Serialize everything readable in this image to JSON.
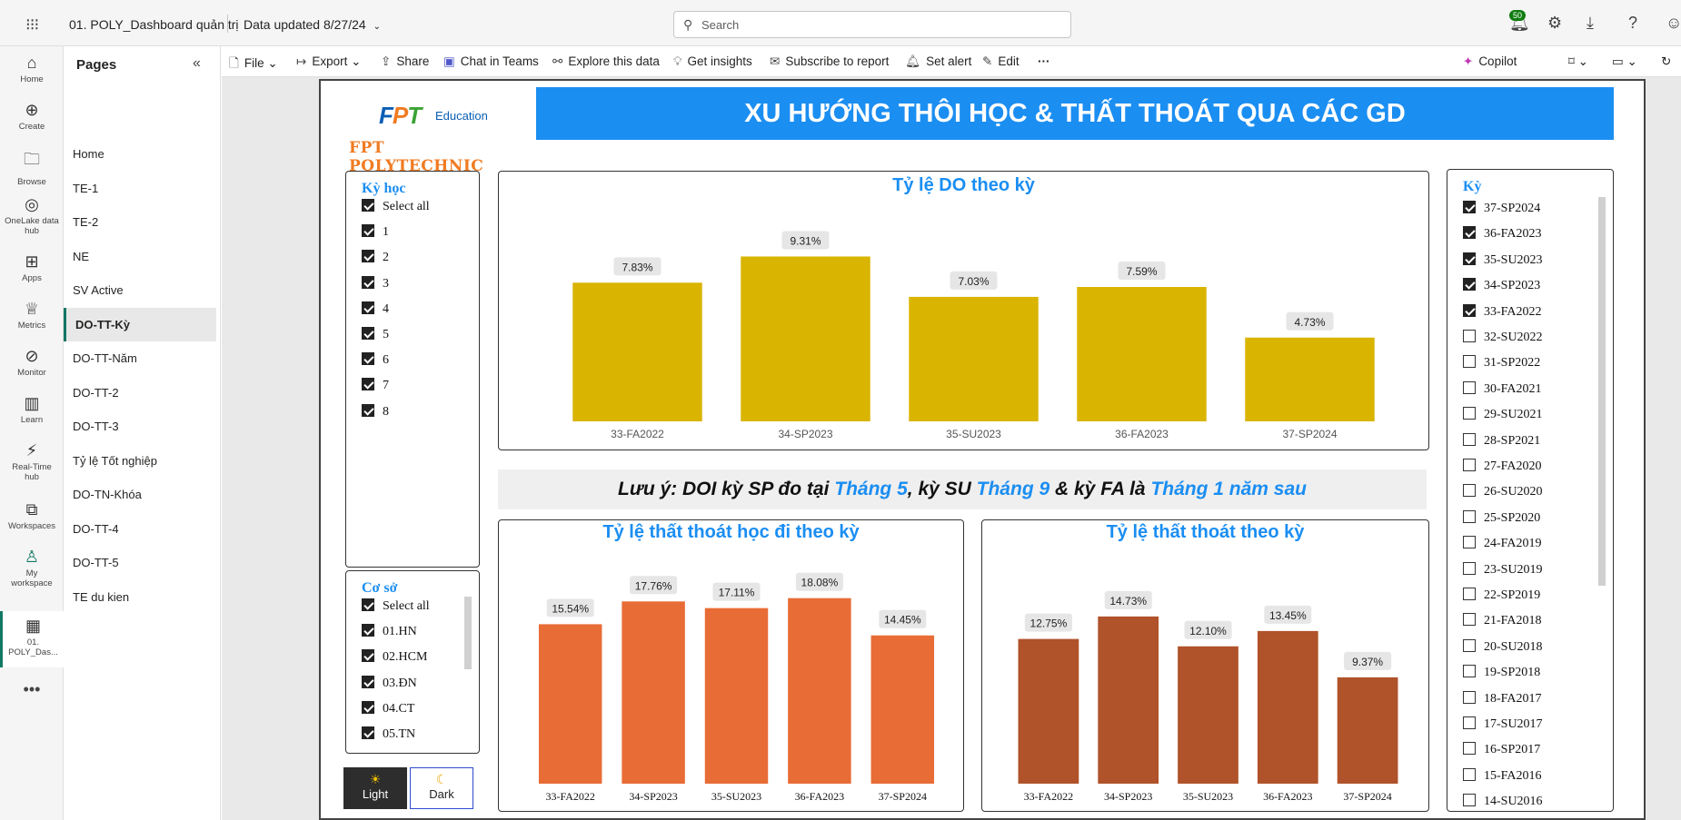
{
  "topbar": {
    "report_title": "01. POLY_Dashboard quản trị",
    "data_updated": "Data updated 8/27/24",
    "search_placeholder": "Search",
    "notif_count": "50"
  },
  "rail": [
    {
      "label": "Home",
      "icon": "home-icon"
    },
    {
      "label": "Create",
      "icon": "plus-circle-icon"
    },
    {
      "label": "Browse",
      "icon": "folder-icon"
    },
    {
      "label": "OneLake data hub",
      "icon": "onelake-icon"
    },
    {
      "label": "Apps",
      "icon": "apps-icon"
    },
    {
      "label": "Metrics",
      "icon": "trophy-icon"
    },
    {
      "label": "Monitor",
      "icon": "monitor-icon"
    },
    {
      "label": "Learn",
      "icon": "book-icon"
    },
    {
      "label": "Real-Time hub",
      "icon": "realtime-icon"
    },
    {
      "label": "Workspaces",
      "icon": "workspaces-icon"
    },
    {
      "label": "My workspace",
      "icon": "person-icon"
    },
    {
      "label": "01. POLY_Das...",
      "icon": "report-icon"
    }
  ],
  "pages": {
    "header": "Pages",
    "items": [
      "Home",
      "TE-1",
      "TE-2",
      "NE",
      "SV Active",
      "DO-TT-Kỳ",
      "DO-TT-Năm",
      "DO-TT-2",
      "DO-TT-3",
      "Tỷ lệ Tốt nghiệp",
      "DO-TN-Khóa",
      "DO-TT-4",
      "DO-TT-5",
      "TE du kien"
    ],
    "active": "DO-TT-Kỳ"
  },
  "commands": [
    "File",
    "Export",
    "Share",
    "Chat in Teams",
    "Explore this data",
    "Get insights",
    "Subscribe to report",
    "Set alert",
    "Edit"
  ],
  "copilot": "Copilot",
  "report": {
    "logo_fpt": "FPT",
    "logo_edu": "Education",
    "logo_poly": "FPT POLYTECHNIC",
    "title": "XU HƯỚNG THÔI HỌC & THẤT THOÁT QUA CÁC GD",
    "note_parts": [
      "Lưu ý: DOI kỳ SP đo tại ",
      "Tháng 5",
      ", kỳ SU ",
      "Tháng 9",
      " & kỳ FA là ",
      "Tháng 1 năm sau"
    ],
    "ky_hoc_slicer": {
      "title": "Kỳ học",
      "items": [
        {
          "label": "Select all",
          "checked": true
        },
        {
          "label": "1",
          "checked": true
        },
        {
          "label": "2",
          "checked": true
        },
        {
          "label": "3",
          "checked": true
        },
        {
          "label": "4",
          "checked": true
        },
        {
          "label": "5",
          "checked": true
        },
        {
          "label": "6",
          "checked": true
        },
        {
          "label": "7",
          "checked": true
        },
        {
          "label": "8",
          "checked": true
        }
      ]
    },
    "co_so_slicer": {
      "title": "Cơ sở",
      "items": [
        {
          "label": "Select all",
          "checked": true
        },
        {
          "label": "01.HN",
          "checked": true
        },
        {
          "label": "02.HCM",
          "checked": true
        },
        {
          "label": "03.ĐN",
          "checked": true
        },
        {
          "label": "04.CT",
          "checked": true
        },
        {
          "label": "05.TN",
          "checked": true
        }
      ]
    },
    "ky_slicer": {
      "title": "Kỳ",
      "items": [
        {
          "label": "37-SP2024",
          "checked": true
        },
        {
          "label": "36-FA2023",
          "checked": true
        },
        {
          "label": "35-SU2023",
          "checked": true
        },
        {
          "label": "34-SP2023",
          "checked": true
        },
        {
          "label": "33-FA2022",
          "checked": true
        },
        {
          "label": "32-SU2022",
          "checked": false
        },
        {
          "label": "31-SP2022",
          "checked": false
        },
        {
          "label": "30-FA2021",
          "checked": false
        },
        {
          "label": "29-SU2021",
          "checked": false
        },
        {
          "label": "28-SP2021",
          "checked": false
        },
        {
          "label": "27-FA2020",
          "checked": false
        },
        {
          "label": "26-SU2020",
          "checked": false
        },
        {
          "label": "25-SP2020",
          "checked": false
        },
        {
          "label": "24-FA2019",
          "checked": false
        },
        {
          "label": "23-SU2019",
          "checked": false
        },
        {
          "label": "22-SP2019",
          "checked": false
        },
        {
          "label": "21-FA2018",
          "checked": false
        },
        {
          "label": "20-SU2018",
          "checked": false
        },
        {
          "label": "19-SP2018",
          "checked": false
        },
        {
          "label": "18-FA2017",
          "checked": false
        },
        {
          "label": "17-SU2017",
          "checked": false
        },
        {
          "label": "16-SP2017",
          "checked": false
        },
        {
          "label": "15-FA2016",
          "checked": false
        },
        {
          "label": "14-SU2016",
          "checked": false
        }
      ]
    },
    "theme": {
      "light": "Light",
      "dark": "Dark",
      "active": "Light"
    }
  },
  "chart_data": [
    {
      "type": "bar",
      "title": "Tỷ lệ DO theo kỳ",
      "categories": [
        "33-FA2022",
        "34-SP2023",
        "35-SU2023",
        "36-FA2023",
        "37-SP2024"
      ],
      "values": [
        7.83,
        9.31,
        7.03,
        7.59,
        4.73
      ],
      "labels": [
        "7.83%",
        "9.31%",
        "7.03%",
        "7.59%",
        "4.73%"
      ],
      "color": "#d9b400",
      "ylim": [
        0,
        10
      ]
    },
    {
      "type": "bar",
      "title": "Tỷ lệ thất thoát học đi theo kỳ",
      "categories": [
        "33-FA2022",
        "34-SP2023",
        "35-SU2023",
        "36-FA2023",
        "37-SP2024"
      ],
      "values": [
        15.54,
        17.76,
        17.11,
        18.08,
        14.45
      ],
      "labels": [
        "15.54%",
        "17.76%",
        "17.11%",
        "18.08%",
        "14.45%"
      ],
      "color": "#e86c35",
      "ylim": [
        0,
        20
      ]
    },
    {
      "type": "bar",
      "title": "Tỷ lệ thất thoát theo kỳ",
      "categories": [
        "33-FA2022",
        "34-SP2023",
        "35-SU2023",
        "36-FA2023",
        "37-SP2024"
      ],
      "values": [
        12.75,
        14.73,
        12.1,
        13.45,
        9.37
      ],
      "labels": [
        "12.75%",
        "14.73%",
        "12.10%",
        "13.45%",
        "9.37%"
      ],
      "color": "#b0522a",
      "ylim": [
        0,
        16
      ]
    }
  ]
}
